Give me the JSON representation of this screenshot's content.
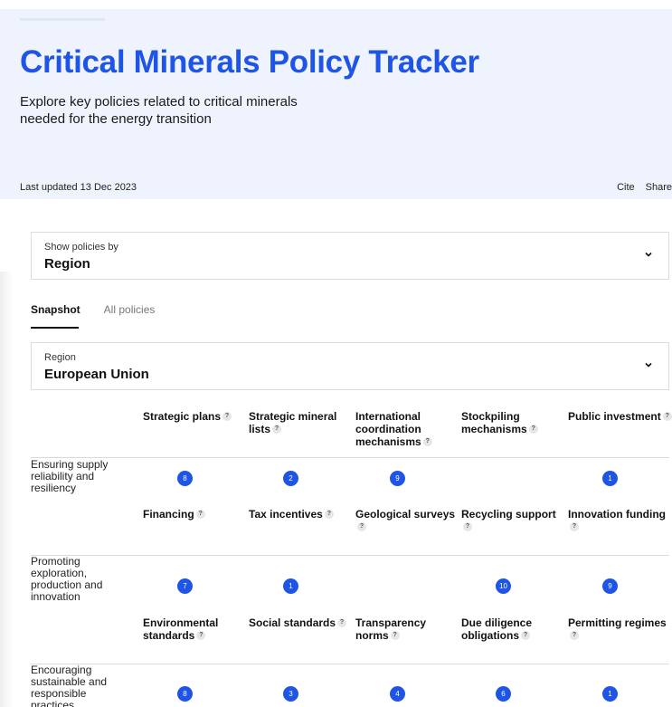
{
  "hero": {
    "title": "Critical Minerals Policy Tracker",
    "subtitle": "Explore key policies related to critical minerals needed for the energy transition",
    "updated": "Last updated 13 Dec 2023",
    "cite": "Cite",
    "share": "Share"
  },
  "filter": {
    "label": "Show policies by",
    "value": "Region"
  },
  "tabs": [
    {
      "label": "Snapshot"
    },
    {
      "label": "All policies"
    }
  ],
  "region": {
    "label": "Region",
    "value": "European Union"
  },
  "sections": [
    {
      "row_label": "Ensuring supply reliability and resiliency",
      "headers": [
        "Strategic plans",
        "Strategic mineral lists",
        "International coordination mechanisms",
        "Stockpiling mechanisms",
        "Public investment"
      ],
      "counts": [
        "8",
        "2",
        "9",
        "",
        "1"
      ]
    },
    {
      "row_label": "Promoting exploration, production and innovation",
      "headers": [
        "Financing",
        "Tax incentives",
        "Geological surveys",
        "Recycling support",
        "Innovation funding"
      ],
      "counts": [
        "7",
        "1",
        "",
        "10",
        "9"
      ]
    },
    {
      "row_label": "Encouraging sustainable and responsible practices",
      "headers": [
        "Environmental standards",
        "Social standards",
        "Transparency norms",
        "Due diligence obligations",
        "Permitting regimes"
      ],
      "counts": [
        "8",
        "3",
        "4",
        "6",
        "1"
      ]
    }
  ],
  "colors": {
    "accent": "#1f55e6",
    "hero_bg": "#eef3fd"
  },
  "icons": {
    "help": "?",
    "dropdown": "chevron-down-icon"
  }
}
